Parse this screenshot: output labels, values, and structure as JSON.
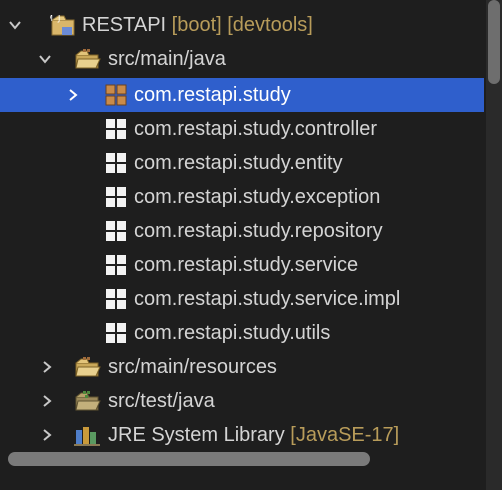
{
  "project": {
    "name": "RESTAPI",
    "decorations": "[boot] [devtools]",
    "icon": "project-folder-icon"
  },
  "tree": {
    "src_main_java": {
      "label": "src/main/java",
      "icon": "source-folder-icon"
    },
    "packages": [
      {
        "label": "com.restapi.study",
        "icon": "package-icon",
        "selected": true
      },
      {
        "label": "com.restapi.study.controller",
        "icon": "package-icon"
      },
      {
        "label": "com.restapi.study.entity",
        "icon": "package-icon"
      },
      {
        "label": "com.restapi.study.exception",
        "icon": "package-icon"
      },
      {
        "label": "com.restapi.study.repository",
        "icon": "package-icon"
      },
      {
        "label": "com.restapi.study.service",
        "icon": "package-icon"
      },
      {
        "label": "com.restapi.study.service.impl",
        "icon": "package-icon"
      },
      {
        "label": "com.restapi.study.utils",
        "icon": "package-icon"
      }
    ],
    "src_main_resources": {
      "label": "src/main/resources",
      "icon": "source-folder-icon"
    },
    "src_test_java": {
      "label": "src/test/java",
      "icon": "test-source-folder-icon"
    },
    "jre_library": {
      "label": "JRE System Library",
      "decoration": "[JavaSE-17]",
      "icon": "library-icon"
    }
  },
  "colors": {
    "background": "#1e1e1e",
    "selection": "#2f5fcc",
    "decoration": "#b89c5a",
    "text": "#d4d4d4"
  }
}
